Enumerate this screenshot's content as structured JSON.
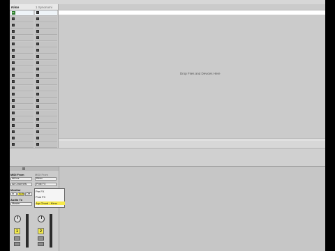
{
  "tracks": [
    {
      "title": "Kimo"
    },
    {
      "title": "1 Synonomi"
    }
  ],
  "arrangement": {
    "hint": "Drop Files and Devices Here"
  },
  "mixer": {
    "midi_from_label": "MIDI From",
    "midi_from_value": "All Ins",
    "channel_value": "All Channels",
    "monitor_label": "Monitor",
    "monitor_in": "In",
    "monitor_auto": "Auto",
    "monitor_off": "Off",
    "audio_to_label": "Audio To",
    "audio_to_value": "Master",
    "track2_from_label": "MIDI From",
    "track2_from_value": "Kimo",
    "track2_post_value": "Post FX",
    "track_number_1": "1",
    "track_number_2": "2"
  },
  "popup": {
    "items": [
      "Pre FX",
      "Post FX",
      "Arp Chord - Kimo"
    ]
  },
  "colors": {
    "accent_yellow": "#f2e94a",
    "play_green": "#2d7a2d",
    "background": "#d7d7d7"
  }
}
